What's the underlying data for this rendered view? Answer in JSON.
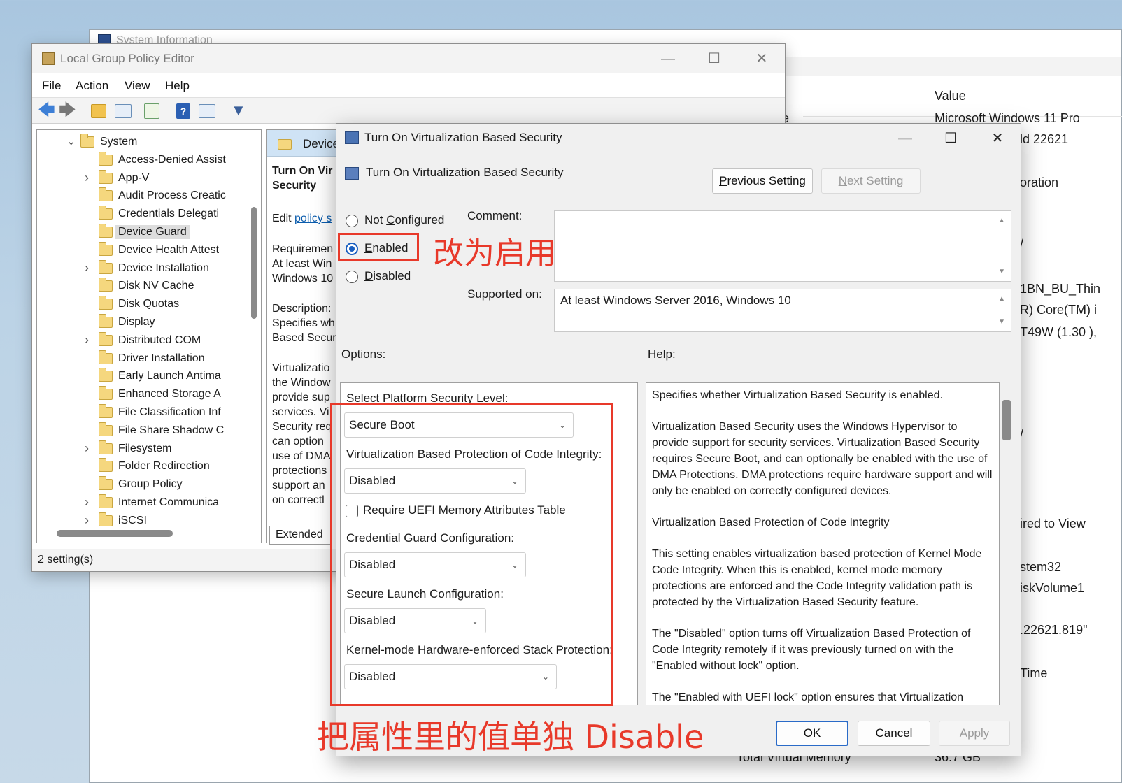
{
  "sysinfo": {
    "title": "System Information",
    "column_value": "Value",
    "values": [
      "Microsoft Windows 11 Pro",
      "ld 22621",
      "oration",
      "/",
      "1BN_BU_Thin",
      "R) Core(TM) i",
      "T49W (1.30 ),",
      "/",
      "ired to View",
      "stem32",
      "iskVolume1",
      ".22621.819\"",
      "Time"
    ],
    "row_item_fragment": "e",
    "bottom_item": "Total Virtual Memory",
    "bottom_value": "36.7 GB"
  },
  "gpedit": {
    "title": "Local Group Policy Editor",
    "menu": [
      "File",
      "Action",
      "View",
      "Help"
    ],
    "tree": [
      {
        "label": "System",
        "expand": "open",
        "level": 0
      },
      {
        "label": "Access-Denied Assist",
        "expand": "",
        "level": 1
      },
      {
        "label": "App-V",
        "expand": "closed",
        "level": 1
      },
      {
        "label": "Audit Process Creatic",
        "expand": "",
        "level": 1
      },
      {
        "label": "Credentials Delegati",
        "expand": "",
        "level": 1
      },
      {
        "label": "Device Guard",
        "expand": "",
        "level": 1,
        "selected": true
      },
      {
        "label": "Device Health Attest",
        "expand": "",
        "level": 1
      },
      {
        "label": "Device Installation",
        "expand": "closed",
        "level": 1
      },
      {
        "label": "Disk NV Cache",
        "expand": "",
        "level": 1
      },
      {
        "label": "Disk Quotas",
        "expand": "",
        "level": 1
      },
      {
        "label": "Display",
        "expand": "",
        "level": 1
      },
      {
        "label": "Distributed COM",
        "expand": "closed",
        "level": 1
      },
      {
        "label": "Driver Installation",
        "expand": "",
        "level": 1
      },
      {
        "label": "Early Launch Antima",
        "expand": "",
        "level": 1
      },
      {
        "label": "Enhanced Storage A",
        "expand": "",
        "level": 1
      },
      {
        "label": "File Classification Inf",
        "expand": "",
        "level": 1
      },
      {
        "label": "File Share Shadow C",
        "expand": "",
        "level": 1
      },
      {
        "label": "Filesystem",
        "expand": "closed",
        "level": 1
      },
      {
        "label": "Folder Redirection",
        "expand": "",
        "level": 1
      },
      {
        "label": "Group Policy",
        "expand": "",
        "level": 1
      },
      {
        "label": "Internet Communica",
        "expand": "closed",
        "level": 1
      },
      {
        "label": "iSCSI",
        "expand": "closed",
        "level": 1
      }
    ],
    "right_header": "Device",
    "right_title": "Turn On Vir\nSecurity",
    "right_edit": "Edit ",
    "right_edit_link": "policy s",
    "right_requirements": "Requiremen\nAt least Win\nWindows 10",
    "right_description": "Description:\nSpecifies wh\nBased Secur",
    "right_body": "Virtualizatio\nthe Window\nprovide sup\nservices. Vi\nSecurity req\ncan option\nuse of DMA\nprotections\nsupport an\non correctl",
    "extended_tab": "Extended",
    "status": "2 setting(s)"
  },
  "dialog": {
    "title": "Turn On Virtualization Based Security",
    "subtitle": "Turn On Virtualization Based Security",
    "prev_button": "Previous Setting",
    "next_button": "Next Setting",
    "radio_not_configured": "Not Configured",
    "radio_enabled": "Enabled",
    "radio_disabled": "Disabled",
    "selected_state": "Enabled",
    "comment_label": "Comment:",
    "comment_value": "",
    "supported_label": "Supported on:",
    "supported_value": "At least Windows Server 2016, Windows 10",
    "options_label": "Options:",
    "help_label": "Help:",
    "options": {
      "platform_label": "Select Platform Security Level:",
      "platform_value": "Secure Boot",
      "code_integrity_label": "Virtualization Based Protection of Code Integrity:",
      "code_integrity_value": "Disabled",
      "uefi_checkbox_label": "Require UEFI Memory Attributes Table",
      "uefi_checked": false,
      "credential_guard_label": "Credential Guard Configuration:",
      "credential_guard_value": "Disabled",
      "secure_launch_label": "Secure Launch Configuration:",
      "secure_launch_value": "Disabled",
      "stack_protection_label": "Kernel-mode Hardware-enforced Stack Protection:",
      "stack_protection_value": "Disabled"
    },
    "help": [
      "Specifies whether Virtualization Based Security is enabled.",
      "Virtualization Based Security uses the Windows Hypervisor to provide support for security services. Virtualization Based Security requires Secure Boot, and can optionally be enabled with the use of DMA Protections. DMA protections require hardware support and will only be enabled on correctly configured devices.",
      "Virtualization Based Protection of Code Integrity",
      "This setting enables virtualization based protection of Kernel Mode Code Integrity. When this is enabled, kernel mode memory protections are enforced and the Code Integrity validation path is protected by the Virtualization Based Security feature.",
      "The \"Disabled\" option turns off Virtualization Based Protection of Code Integrity remotely if it was previously turned on with the \"Enabled without lock\" option.",
      "The \"Enabled with UEFI lock\" option ensures that Virtualization"
    ],
    "ok_button": "OK",
    "cancel_button": "Cancel",
    "apply_button": "Apply"
  },
  "annotations": {
    "enable_note": "改为启用",
    "disable_note": "把属性里的值单独 Disable",
    "color": "#e8392a"
  }
}
